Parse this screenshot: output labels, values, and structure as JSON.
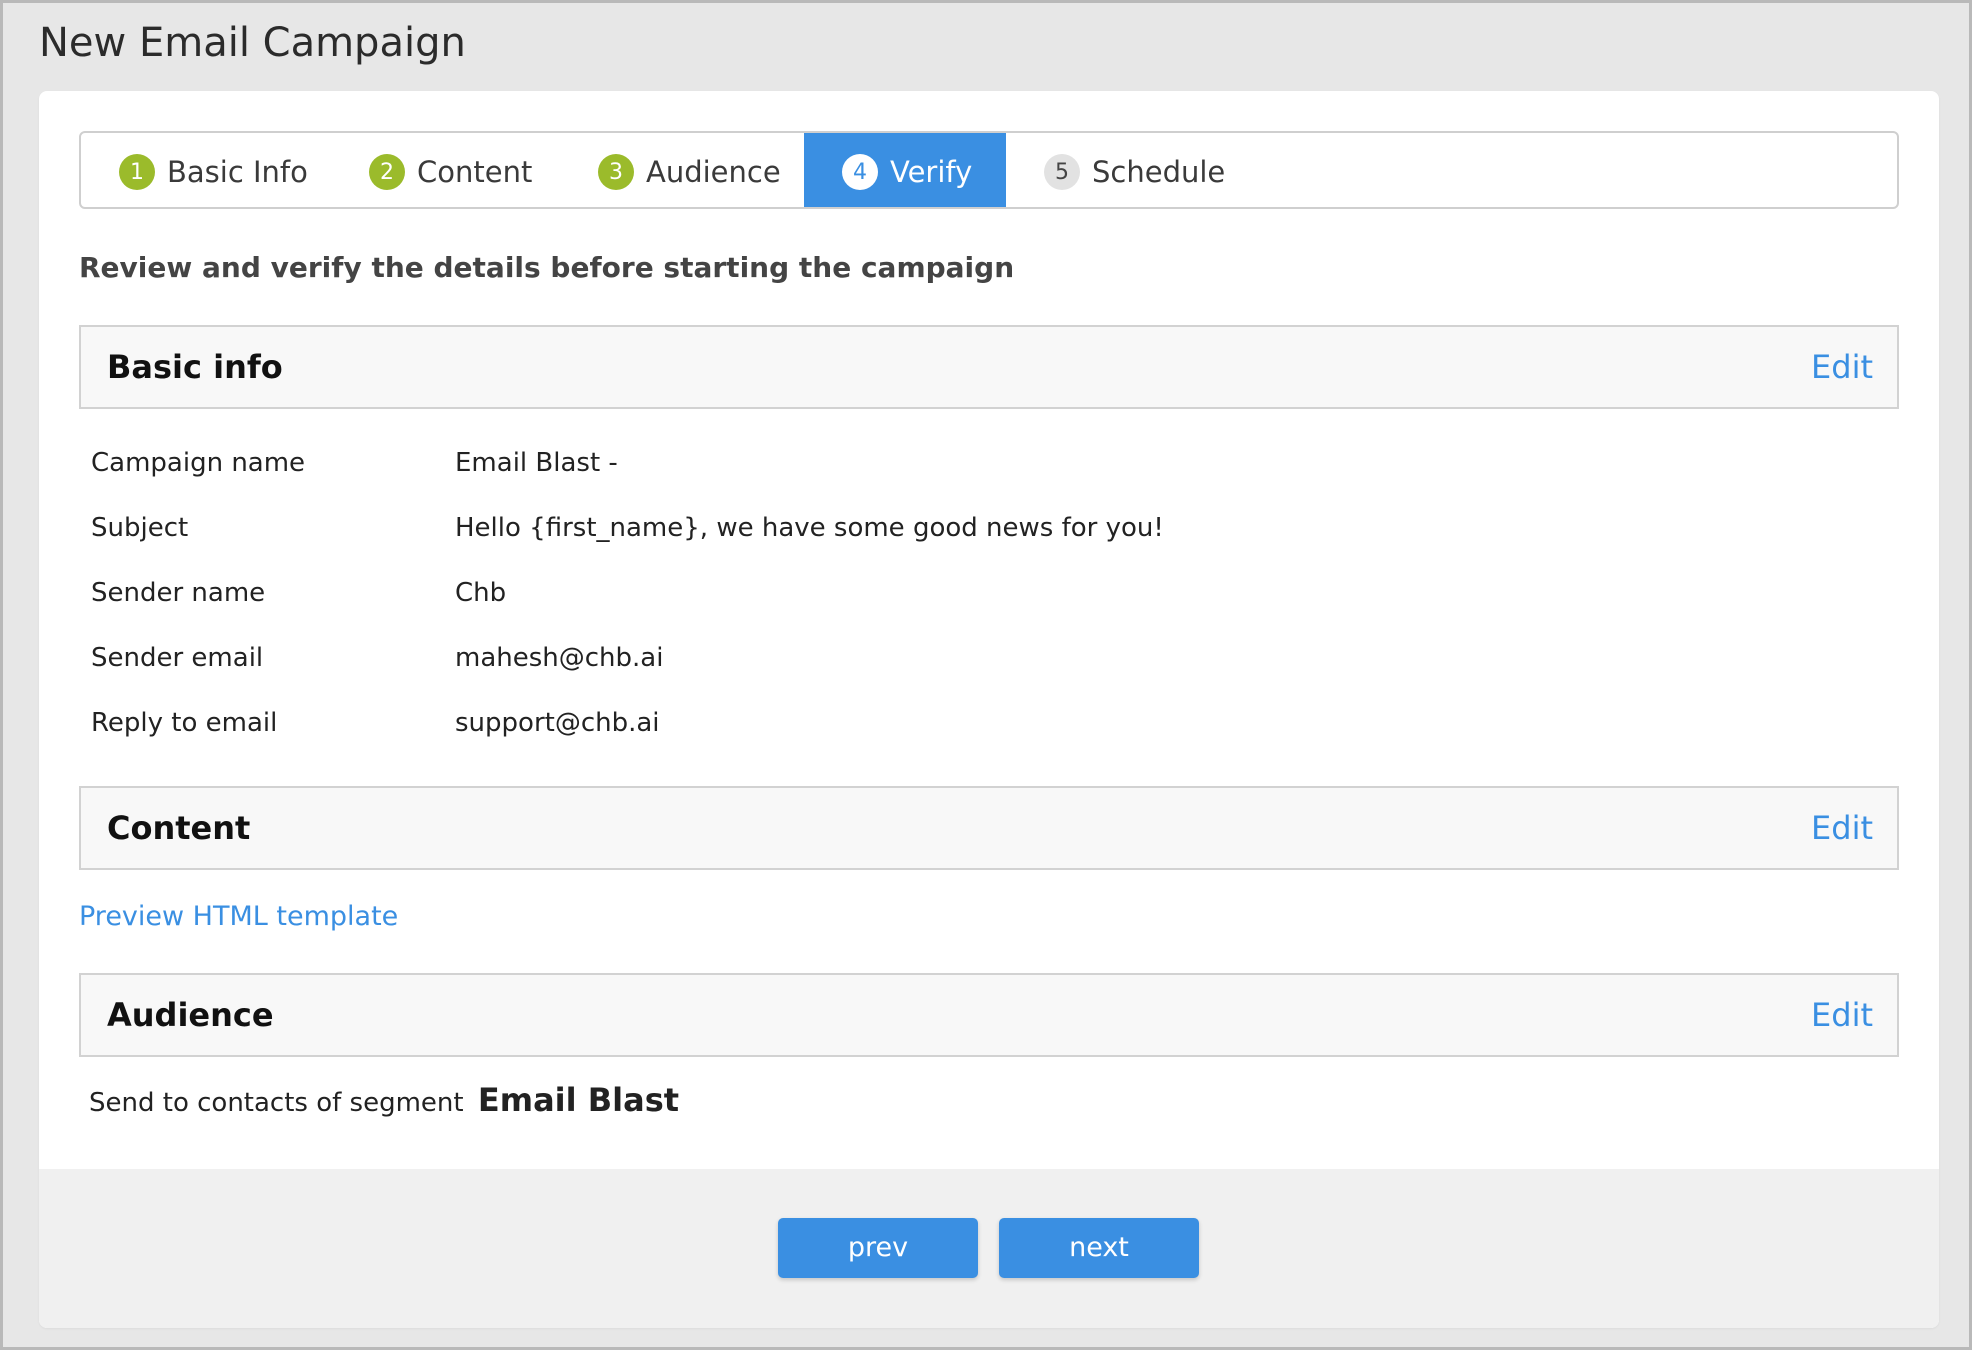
{
  "page": {
    "title": "New Email Campaign"
  },
  "steps": [
    {
      "num": "1",
      "label": "Basic Info",
      "state": "done"
    },
    {
      "num": "2",
      "label": "Content",
      "state": "done"
    },
    {
      "num": "3",
      "label": "Audience",
      "state": "done"
    },
    {
      "num": "4",
      "label": "Verify",
      "state": "active"
    },
    {
      "num": "5",
      "label": "Schedule",
      "state": "todo"
    }
  ],
  "intro": "Review and verify the details before starting the campaign",
  "sections": {
    "basic": {
      "title": "Basic info",
      "edit_label": "Edit"
    },
    "content": {
      "title": "Content",
      "edit_label": "Edit"
    },
    "audience": {
      "title": "Audience",
      "edit_label": "Edit"
    }
  },
  "basic_info": [
    {
      "label": "Campaign name",
      "value": "Email Blast -"
    },
    {
      "label": "Subject",
      "value": "Hello {first_name}, we have some good news for you!"
    },
    {
      "label": "Sender name",
      "value": "Chb"
    },
    {
      "label": "Sender email",
      "value": "mahesh@chb.ai"
    },
    {
      "label": "Reply to email",
      "value": "support@chb.ai"
    }
  ],
  "content": {
    "preview_link": "Preview HTML template"
  },
  "audience": {
    "prefix": "Send to contacts of segment",
    "segment_name": "Email Blast"
  },
  "footer": {
    "prev_label": "prev",
    "next_label": "next"
  },
  "colors": {
    "accent": "#3a8fe2",
    "step_done": "#9bbb2b",
    "step_todo": "#e2e2e2"
  }
}
